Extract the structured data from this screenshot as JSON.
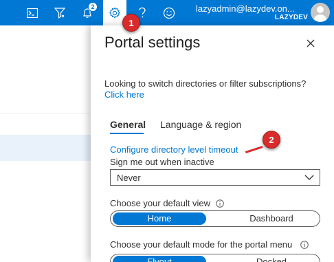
{
  "topbar": {
    "icons": [
      "cloud-shell-icon",
      "directory-filter-icon",
      "notifications-icon",
      "settings-icon",
      "help-icon",
      "feedback-icon"
    ],
    "notification_count": "2",
    "user_name": "lazyadmin@lazydev.on...",
    "tenant": "LAZYDEV",
    "accent_color": "#0078d4"
  },
  "panel": {
    "title": "Portal settings",
    "switch_text": "Looking to switch directories or filter subscriptions?",
    "click_here": "Click here",
    "tabs": [
      {
        "label": "General",
        "selected": true
      },
      {
        "label": "Language & region",
        "selected": false
      }
    ],
    "config_link": "Configure directory level timeout",
    "sign_out_label": "Sign me out when inactive",
    "sign_out_value": "Never",
    "default_view_label": "Choose your default view",
    "default_view_options": [
      "Home",
      "Dashboard"
    ],
    "default_view_selected": "Home",
    "default_mode_label": "Choose your default mode for the portal menu",
    "default_mode_options": [
      "Flyout",
      "Docked"
    ],
    "default_mode_selected": "Flyout"
  },
  "annotations": [
    "1",
    "2"
  ]
}
